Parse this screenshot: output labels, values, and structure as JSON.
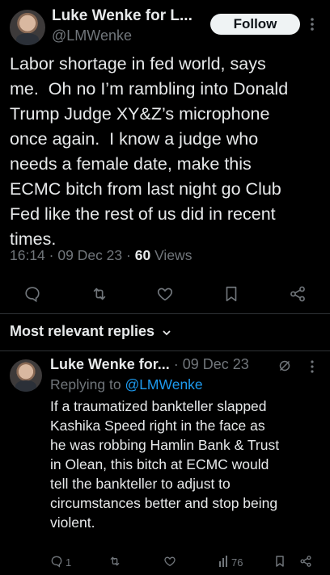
{
  "main_tweet": {
    "author_name": "Luke Wenke for L...",
    "author_handle": "@LMWenke",
    "follow_label": "Follow",
    "text": "Labor shortage in fed world, says\nme.  Oh no I’m rambling into Donald\nTrump Judge XY&Z’s microphone\nonce again.  I know a judge who\nneeds a female date, make this\nECMC bitch from last night go Club\nFed like the rest of us did in recent\ntimes.",
    "time": "16:14",
    "date": "09 Dec 23",
    "views_count": "60",
    "views_label": "Views",
    "actions": [
      "reply-icon",
      "retweet-icon",
      "like-icon",
      "bookmark-icon",
      "share-icon"
    ]
  },
  "replies_header": {
    "label": "Most relevant replies"
  },
  "reply": {
    "author_name": "Luke Wenke for...",
    "date": "09 Dec 23",
    "replying_to_label": "Replying to",
    "replying_to_handle": "@LMWenke",
    "text": "If a traumatized bankteller slapped\nKashika Speed right in the face as\nhe was robbing Hamlin Bank & Trust\nin Olean, this bitch at ECMC would\ntell the bankteller to adjust to\ncircumstances better and stop being\nviolent.",
    "reply_count": "1",
    "views_count": "76"
  },
  "colors": {
    "background": "#000000",
    "text": "#e7e9ea",
    "muted": "#71767b",
    "link": "#1d9bf0",
    "divider": "#2f3336"
  }
}
